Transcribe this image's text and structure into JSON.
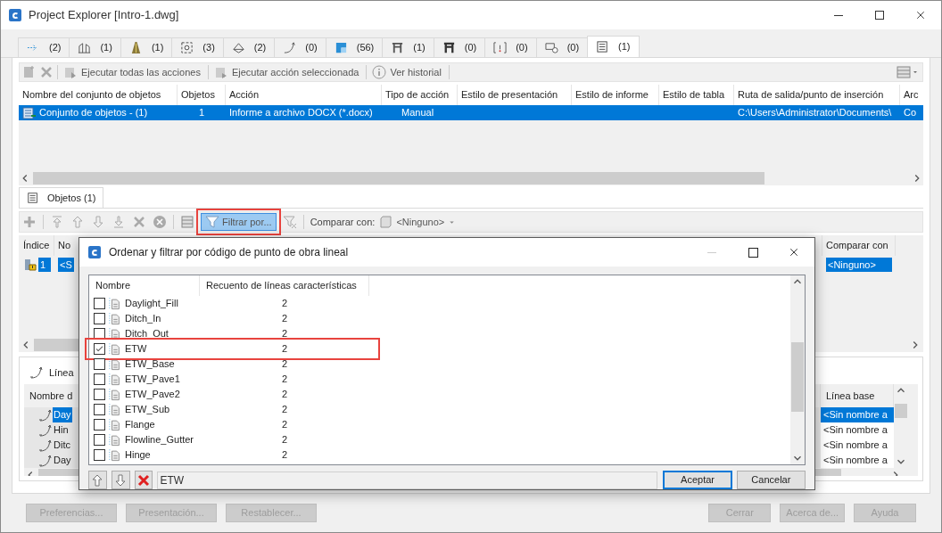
{
  "window": {
    "title": "Project Explorer [Intro-1.dwg]"
  },
  "tabs": [
    {
      "count": "(2)",
      "selected": false
    },
    {
      "count": "(1)",
      "selected": false
    },
    {
      "count": "(1)",
      "selected": false
    },
    {
      "count": "(3)",
      "selected": false
    },
    {
      "count": "(2)",
      "selected": false
    },
    {
      "count": "(0)",
      "selected": false
    },
    {
      "count": "(56)",
      "selected": false
    },
    {
      "count": "(1)",
      "selected": false
    },
    {
      "count": "(0)",
      "selected": false
    },
    {
      "count": "(0)",
      "selected": false
    },
    {
      "count": "(0)",
      "selected": false
    },
    {
      "count": "(1)",
      "selected": true
    }
  ],
  "toolbar": {
    "buttons": [
      {
        "label": "Ejecutar todas las acciones"
      },
      {
        "label": "Ejecutar acción seleccionada"
      },
      {
        "label": "Ver historial"
      }
    ]
  },
  "object_sets": {
    "columns": [
      "Nombre del conjunto de objetos",
      "Objetos",
      "Acción",
      "Tipo de acción",
      "Estilo de presentación",
      "Estilo de informe",
      "Estilo de tabla",
      "Ruta de salida/punto de inserción",
      "Arc"
    ],
    "rows": [
      {
        "cells": [
          "Conjunto de objetos - (1)",
          "1",
          "Informe a archivo DOCX (*.docx)",
          "Manual",
          "",
          "",
          "",
          "C:\\Users\\Administrator\\Documents\\",
          "Co"
        ],
        "selected": true
      }
    ]
  },
  "objects_tab": {
    "label": "Objetos (1)"
  },
  "objects_toolbar": {
    "filter_button": {
      "label": "Filtrar por...",
      "highlighted": true
    },
    "compare_label": "Comparar con:",
    "compare_value": "<Ninguno>"
  },
  "objects_table": {
    "columns": [
      "Índice",
      "No",
      "Comparar con"
    ],
    "rows": [
      {
        "cells": [
          "1",
          "<S",
          "<Ninguno>"
        ],
        "selected": true
      }
    ]
  },
  "baselines": {
    "title": "Línea",
    "columns": [
      "Nombre d",
      "Línea base"
    ],
    "rows": [
      {
        "name": "Day",
        "baseline": "<Sin nombre a",
        "selected": true
      },
      {
        "name": "Hin",
        "baseline": "<Sin nombre a",
        "selected": false
      },
      {
        "name": "Ditc",
        "baseline": "<Sin nombre a",
        "selected": false
      },
      {
        "name": "Day",
        "baseline": "<Sin nombre a",
        "selected": false
      }
    ]
  },
  "dialog": {
    "title": "Ordenar y filtrar por código de punto de obra lineal",
    "columns": [
      "Nombre",
      "Recuento de líneas características"
    ],
    "items": [
      {
        "name": "Daylight_Fill",
        "count": "2",
        "checked": false,
        "highlighted": false
      },
      {
        "name": "Ditch_In",
        "count": "2",
        "checked": false,
        "highlighted": false
      },
      {
        "name": "Ditch_Out",
        "count": "2",
        "checked": false,
        "highlighted": false
      },
      {
        "name": "ETW",
        "count": "2",
        "checked": true,
        "highlighted": true
      },
      {
        "name": "ETW_Base",
        "count": "2",
        "checked": false,
        "highlighted": false
      },
      {
        "name": "ETW_Pave1",
        "count": "2",
        "checked": false,
        "highlighted": false
      },
      {
        "name": "ETW_Pave2",
        "count": "2",
        "checked": false,
        "highlighted": false
      },
      {
        "name": "ETW_Sub",
        "count": "2",
        "checked": false,
        "highlighted": false
      },
      {
        "name": "Flange",
        "count": "2",
        "checked": false,
        "highlighted": false
      },
      {
        "name": "Flowline_Gutter",
        "count": "2",
        "checked": false,
        "highlighted": false
      },
      {
        "name": "Hinge",
        "count": "2",
        "checked": false,
        "highlighted": false
      }
    ],
    "filter_value": "ETW",
    "buttons": [
      {
        "label": "Aceptar",
        "default": true
      },
      {
        "label": "Cancelar",
        "default": false
      }
    ]
  },
  "footer_buttons": [
    {
      "label": "Preferencias...",
      "disabled": true
    },
    {
      "label": "Presentación...",
      "disabled": true
    },
    {
      "label": "Restablecer...",
      "disabled": true
    },
    {
      "label": "Cerrar",
      "disabled": true
    },
    {
      "label": "Acerca de...",
      "disabled": true
    },
    {
      "label": "Ayuda",
      "disabled": true
    }
  ]
}
